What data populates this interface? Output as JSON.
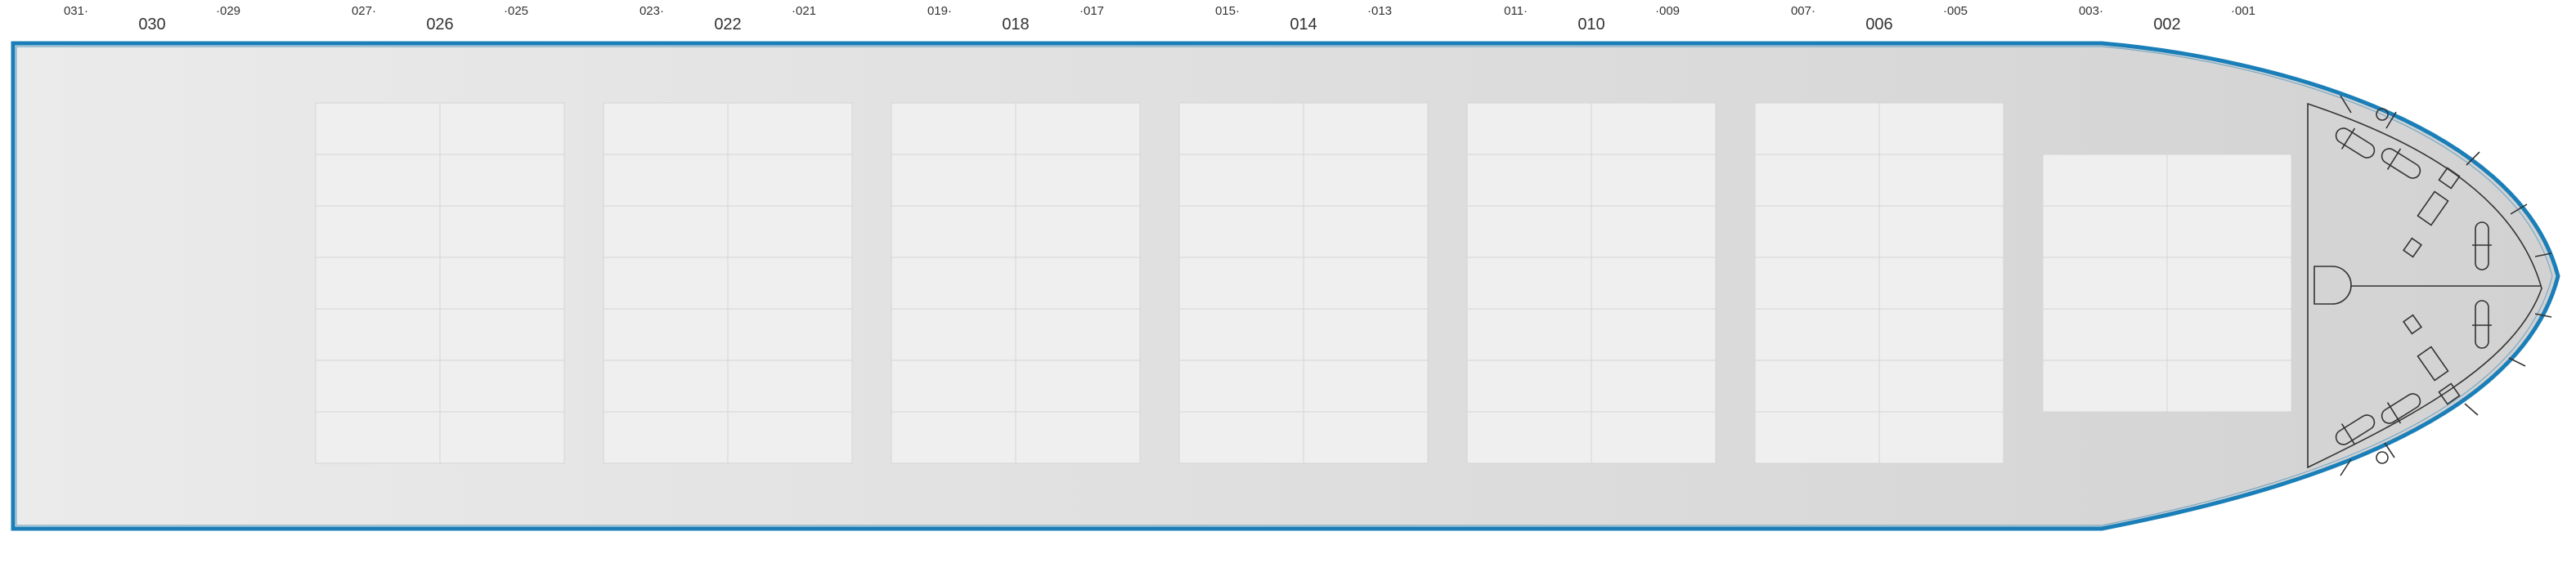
{
  "vessel": {
    "bays": [
      {
        "bay": "030",
        "fwd": "029",
        "aft": "031",
        "rows": 0
      },
      {
        "bay": "026",
        "fwd": "025",
        "aft": "027",
        "rows": 2,
        "tiers": 7
      },
      {
        "bay": "022",
        "fwd": "021",
        "aft": "023",
        "rows": 2,
        "tiers": 7
      },
      {
        "bay": "018",
        "fwd": "017",
        "aft": "019",
        "rows": 2,
        "tiers": 7
      },
      {
        "bay": "014",
        "fwd": "013",
        "aft": "015",
        "rows": 2,
        "tiers": 7
      },
      {
        "bay": "010",
        "fwd": "009",
        "aft": "011",
        "rows": 2,
        "tiers": 7
      },
      {
        "bay": "006",
        "fwd": "005",
        "aft": "007",
        "rows": 2,
        "tiers": 7
      },
      {
        "bay": "002",
        "fwd": "001",
        "aft": "003",
        "rows": 2,
        "tiers": 5
      }
    ],
    "colors": {
      "hull_outline": "#1a7fb8",
      "deck_dark": "#d2d2d2",
      "deck_light": "#ebebeb",
      "slot_fill": "#efefef",
      "slot_line": "#d4d4d4",
      "fitting_stroke": "#333333"
    }
  }
}
